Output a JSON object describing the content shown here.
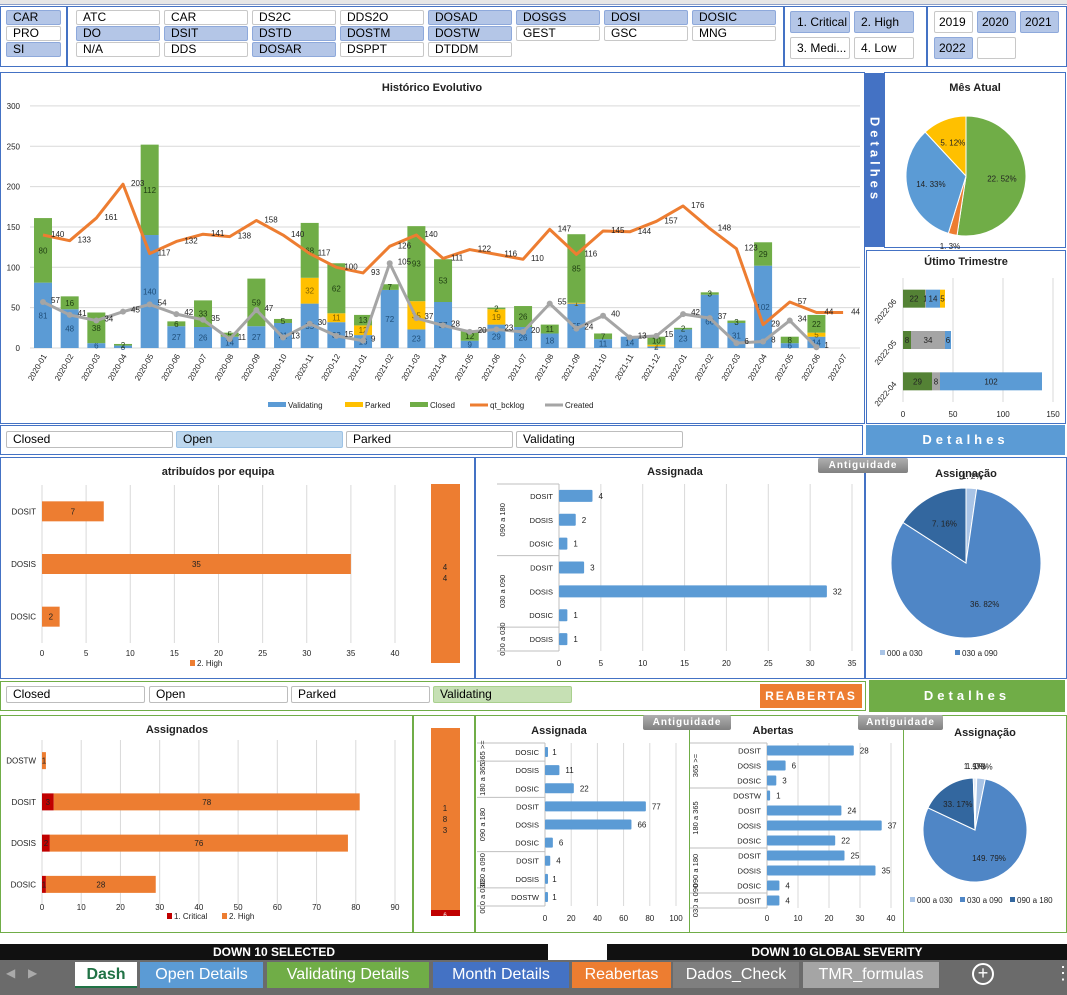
{
  "slicers": {
    "area": [
      {
        "label": "CAR",
        "selected": true
      },
      {
        "label": "PRO",
        "selected": false
      },
      {
        "label": "SI",
        "selected": true
      }
    ],
    "teams": [
      {
        "label": "ATC",
        "selected": false
      },
      {
        "label": "CAR",
        "selected": false
      },
      {
        "label": "DS2C",
        "selected": false
      },
      {
        "label": "DDS2O",
        "selected": false
      },
      {
        "label": "DOSAD",
        "selected": true
      },
      {
        "label": "DOSGS",
        "selected": true
      },
      {
        "label": "DOSI",
        "selected": true
      },
      {
        "label": "DOSIC",
        "selected": true
      },
      {
        "label": "DO",
        "selected": true
      },
      {
        "label": "DSIT",
        "selected": true
      },
      {
        "label": "DSTD",
        "selected": true
      },
      {
        "label": "DOSTM",
        "selected": true
      },
      {
        "label": "DOSTW",
        "selected": true
      },
      {
        "label": "GEST",
        "selected": false
      },
      {
        "label": "GSC",
        "selected": false
      },
      {
        "label": "MNG",
        "selected": false
      },
      {
        "label": "N/A",
        "selected": false
      },
      {
        "label": "DDS",
        "selected": false
      },
      {
        "label": "DOSAR",
        "selected": true
      },
      {
        "label": "DSPPT",
        "selected": false
      },
      {
        "label": "DTDDM",
        "selected": false
      }
    ],
    "severity": [
      {
        "label": "1. Critical",
        "selected": true
      },
      {
        "label": "2. High",
        "selected": true
      },
      {
        "label": "3. Medi...",
        "selected": false
      },
      {
        "label": "4. Low",
        "selected": false
      }
    ],
    "years": [
      {
        "label": "2019",
        "selected": false
      },
      {
        "label": "2020",
        "selected": true
      },
      {
        "label": "2021",
        "selected": true
      },
      {
        "label": "2022",
        "selected": true
      },
      {
        "label": "",
        "selected": false
      }
    ]
  },
  "side_buttons": {
    "detalhes_vertical": "Detalhes",
    "detalhes_blue": "Detalhes",
    "detalhes_green": "Detalhes",
    "reabertas": "REABERTAS",
    "antiguidade": "Antiguidade"
  },
  "status_filter_1": [
    {
      "label": "Closed",
      "selected": false
    },
    {
      "label": "Open",
      "selected": true
    },
    {
      "label": "Parked",
      "selected": false
    },
    {
      "label": "Validating",
      "selected": false
    }
  ],
  "status_filter_2": [
    {
      "label": "Closed",
      "selected": false
    },
    {
      "label": "Open",
      "selected": false
    },
    {
      "label": "Parked",
      "selected": false
    },
    {
      "label": "Validating",
      "selected": true
    }
  ],
  "colors": {
    "validating": "#5b9bd5",
    "parked": "#ffc000",
    "closed": "#70ad47",
    "backlog": "#ed7d31",
    "created": "#a5a5a5",
    "high": "#ed7d31",
    "critical": "#c00000",
    "blue_bar": "#5b9bd5"
  },
  "chart_data": [
    {
      "id": "historico",
      "type": "bar+line",
      "title": "Histórico Evolutivo",
      "ylim": [
        0,
        300
      ],
      "yticks": [
        0,
        50,
        100,
        150,
        200,
        250,
        300
      ],
      "grid": true,
      "legend": "bottom",
      "categories": [
        "2020-01",
        "2020-02",
        "2020-03",
        "2020-04",
        "2020-05",
        "2020-06",
        "2020-07",
        "2020-08",
        "2020-09",
        "2020-10",
        "2020-11",
        "2020-12",
        "2021-01",
        "2021-02",
        "2021-03",
        "2021-04",
        "2021-05",
        "2021-06",
        "2021-07",
        "2021-08",
        "2021-09",
        "2021-10",
        "2021-11",
        "2021-12",
        "2022-01",
        "2022-02",
        "2022-03",
        "2022-04",
        "2022-05",
        "2022-06",
        "2022-07"
      ],
      "series": [
        {
          "name": "Validating",
          "kind": "stacked-bar",
          "values": [
            81,
            48,
            6,
            3,
            140,
            27,
            26,
            14,
            27,
            31,
            55,
            32,
            16,
            72,
            23,
            57,
            9,
            29,
            26,
            18,
            55,
            11,
            14,
            2,
            23,
            66,
            31,
            102,
            6,
            14,
            0
          ]
        },
        {
          "name": "Parked",
          "kind": "stacked-bar",
          "values": [
            0,
            0,
            0,
            0,
            0,
            0,
            0,
            0,
            0,
            0,
            32,
            11,
            12,
            0,
            35,
            0,
            0,
            19,
            0,
            0,
            1,
            0,
            0,
            2,
            0,
            0,
            0,
            0,
            0,
            5,
            0
          ]
        },
        {
          "name": "Closed",
          "kind": "stacked-bar",
          "values": [
            80,
            16,
            38,
            2,
            112,
            6,
            33,
            5,
            59,
            5,
            68,
            62,
            13,
            7,
            93,
            53,
            12,
            2,
            26,
            11,
            85,
            7,
            0,
            10,
            2,
            3,
            3,
            29,
            8,
            22,
            0
          ]
        },
        {
          "name": "qt_bcklog",
          "kind": "line",
          "values": [
            140,
            133,
            161,
            203,
            117,
            132,
            141,
            138,
            158,
            140,
            117,
            100,
            93,
            126,
            140,
            111,
            122,
            116,
            110,
            147,
            116,
            145,
            144,
            157,
            176,
            148,
            123,
            29,
            57,
            44,
            44
          ]
        },
        {
          "name": "Created",
          "kind": "line",
          "values": [
            57,
            41,
            34,
            45,
            54,
            42,
            35,
            11,
            47,
            13,
            30,
            15,
            9,
            105,
            37,
            28,
            20,
            23,
            20,
            55,
            24,
            40,
            13,
            15,
            42,
            37,
            6,
            8,
            34,
            1,
            null
          ]
        }
      ]
    },
    {
      "id": "mes_atual",
      "type": "pie",
      "title": "Mês Atual",
      "slices": [
        {
          "value": 22,
          "label": "22. 52%",
          "color": "#70ad47"
        },
        {
          "value": 1,
          "label": "1. 3%",
          "color": "#ed7d31"
        },
        {
          "value": 14,
          "label": "14. 33%",
          "color": "#5b9bd5"
        },
        {
          "value": 5,
          "label": "5. 12%",
          "color": "#ffc000"
        }
      ]
    },
    {
      "id": "trimestre",
      "type": "stacked-hbar",
      "title": "Útimo Trimestre",
      "xlim": [
        0,
        150
      ],
      "xticks": [
        0,
        50,
        100,
        150
      ],
      "categories": [
        "2022-06",
        "2022-05",
        "2022-04"
      ],
      "series": [
        {
          "color": "#548235",
          "values": [
            22,
            8,
            29
          ]
        },
        {
          "color": "#a5a5a5",
          "values": [
            1,
            34,
            8
          ]
        },
        {
          "color": "#5b9bd5",
          "values": [
            14,
            6,
            102
          ]
        },
        {
          "color": "#ffc000",
          "values": [
            5,
            0,
            0
          ]
        }
      ]
    },
    {
      "id": "atribuidos",
      "type": "hbar",
      "title": "atribuídos por equipa",
      "xlim": [
        0,
        45
      ],
      "xticks": [
        0,
        5,
        10,
        15,
        20,
        25,
        30,
        35,
        40
      ],
      "legend": "bottom",
      "categories": [
        "DOSIT",
        "DOSIS",
        "DOSIC"
      ],
      "series": [
        {
          "name": "2. High",
          "color": "#ed7d31",
          "values": [
            7,
            35,
            2
          ]
        }
      ],
      "total": {
        "value": 44,
        "label": "4\n4"
      }
    },
    {
      "id": "assignada_open",
      "type": "grouped-hbar",
      "title": "Assignada",
      "xlim": [
        0,
        35
      ],
      "xticks": [
        0,
        5,
        10,
        15,
        20,
        25,
        30,
        35
      ],
      "groups": [
        {
          "name": "090 a 180",
          "rows": [
            [
              "DOSIT",
              4
            ],
            [
              "DOSIS",
              2
            ],
            [
              "DOSIC",
              1
            ]
          ]
        },
        {
          "name": "030 a 090",
          "rows": [
            [
              "DOSIT",
              3
            ],
            [
              "DOSIS",
              32
            ],
            [
              "DOSIC",
              1
            ]
          ]
        },
        {
          "name": "000 a 030",
          "rows": [
            [
              "DOSIS",
              1
            ]
          ]
        }
      ]
    },
    {
      "id": "assignacao_open",
      "type": "pie",
      "title": "Assignação",
      "legend": [
        "000 a 030",
        "030 a 090"
      ],
      "slices": [
        {
          "value": 1,
          "label": "1. 2%",
          "color": "#a9c4e6"
        },
        {
          "value": 36,
          "label": "36. 82%",
          "color": "#4f86c6"
        },
        {
          "value": 7,
          "label": "7. 16%",
          "color": "#33679f"
        }
      ]
    },
    {
      "id": "assignados",
      "type": "stacked-hbar",
      "title": "Assignados",
      "xlim": [
        0,
        95
      ],
      "xticks": [
        0,
        10,
        20,
        30,
        40,
        50,
        60,
        70,
        80,
        90
      ],
      "legend": "bottom",
      "categories": [
        "DOSTW",
        "DOSIT",
        "DOSIS",
        "DOSIC"
      ],
      "series": [
        {
          "name": "1. Critical",
          "color": "#c00000",
          "values": [
            0,
            3,
            2,
            1
          ]
        },
        {
          "name": "2. High",
          "color": "#ed7d31",
          "values": [
            1,
            78,
            76,
            28
          ]
        }
      ],
      "total": {
        "high": 183,
        "critical": 6,
        "label": "1\n8\n3",
        "critical_label": "6"
      }
    },
    {
      "id": "assignada_val",
      "type": "grouped-hbar",
      "title": "Assignada",
      "xlim": [
        0,
        100
      ],
      "xticks": [
        0,
        20,
        40,
        60,
        80,
        100
      ],
      "groups": [
        {
          "name": "365 >=",
          "rows": [
            [
              "DOSIC",
              1
            ]
          ]
        },
        {
          "name": "180 a 365",
          "rows": [
            [
              "DOSIS",
              11
            ],
            [
              "DOSIC",
              22
            ]
          ]
        },
        {
          "name": "090 a 180",
          "rows": [
            [
              "DOSIT",
              77
            ],
            [
              "DOSIS",
              66
            ],
            [
              "DOSIC",
              6
            ]
          ]
        },
        {
          "name": "030 a 090",
          "rows": [
            [
              "DOSIT",
              4
            ],
            [
              "DOSIS",
              1
            ]
          ]
        },
        {
          "name": "000 a 030",
          "rows": [
            [
              "DOSTW",
              1
            ]
          ]
        }
      ]
    },
    {
      "id": "abertas",
      "type": "grouped-hbar",
      "title": "Abertas",
      "xlim": [
        0,
        40
      ],
      "xticks": [
        0,
        10,
        20,
        30,
        40
      ],
      "groups": [
        {
          "name": "365 >=",
          "rows": [
            [
              "DOSIT",
              28
            ],
            [
              "DOSIS",
              6
            ],
            [
              "DOSIC",
              3
            ]
          ]
        },
        {
          "name": "180 a 365",
          "rows": [
            [
              "DOSTW",
              1
            ],
            [
              "DOSIT",
              24
            ],
            [
              "DOSIS",
              37
            ],
            [
              "DOSIC",
              22
            ]
          ]
        },
        {
          "name": "090 a 180",
          "rows": [
            [
              "DOSIT",
              25
            ],
            [
              "DOSIS",
              35
            ],
            [
              "DOSIC",
              4
            ]
          ]
        },
        {
          "name": "030 a 090",
          "rows": [
            [
              "DOSIT",
              4
            ]
          ]
        }
      ]
    },
    {
      "id": "assignacao_val",
      "type": "pie",
      "title": "Assignação",
      "legend": [
        "000 a 030",
        "030 a 090",
        "090 a 180"
      ],
      "slices": [
        {
          "value": 1,
          "label": "1. 0%",
          "color": "#d6e2f2"
        },
        {
          "value": 5,
          "label": "5. 3%",
          "color": "#a9c4e6"
        },
        {
          "value": 149,
          "label": "149. 79%",
          "color": "#4f86c6"
        },
        {
          "value": 33,
          "label": "33. 17%",
          "color": "#33679f"
        },
        {
          "value": 1,
          "label": "1. 1%",
          "color": "#bfd3ec"
        }
      ]
    }
  ],
  "footer": {
    "left_banner": "DOWN 10 SELECTED",
    "right_banner": "DOWN 10 GLOBAL SEVERITY"
  },
  "sheet_tabs": [
    {
      "label": "Dash",
      "active": true,
      "color": "#ffffff"
    },
    {
      "label": "Open Details",
      "color": "#5b9bd5"
    },
    {
      "label": "Validating Details",
      "color": "#70ad47"
    },
    {
      "label": "Month Details",
      "color": "#4472c4"
    },
    {
      "label": "Reabertas",
      "color": "#ed7d31"
    },
    {
      "label": "Dados_Check",
      "color": "#7f7f7f"
    },
    {
      "label": "TMR_formulas",
      "color": "#a5a5a5"
    }
  ]
}
